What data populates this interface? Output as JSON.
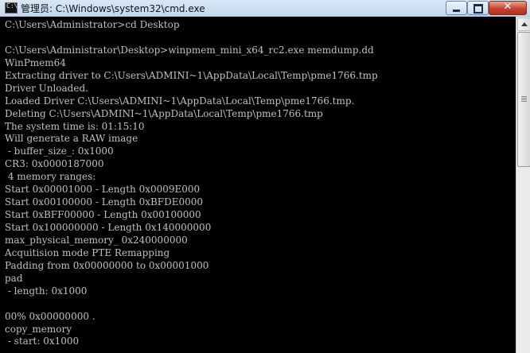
{
  "window": {
    "title": "管理员: C:\\Windows\\system32\\cmd.exe",
    "icon": "cmd-icon",
    "icon_glyph": "C:\\",
    "controls": {
      "minimize_icon": "minimize-icon",
      "maximize_icon": "maximize-icon",
      "close_icon": "close-icon",
      "close_glyph": "✕"
    }
  },
  "console": {
    "lines": [
      "C:\\Users\\Administrator>cd Desktop",
      "",
      "C:\\Users\\Administrator\\Desktop>winpmem_mini_x64_rc2.exe memdump.dd",
      "WinPmem64",
      "Extracting driver to C:\\Users\\ADMINI~1\\AppData\\Local\\Temp\\pme1766.tmp",
      "Driver Unloaded.",
      "Loaded Driver C:\\Users\\ADMINI~1\\AppData\\Local\\Temp\\pme1766.tmp.",
      "Deleting C:\\Users\\ADMINI~1\\AppData\\Local\\Temp\\pme1766.tmp",
      "The system time is: 01:15:10",
      "Will generate a RAW image",
      " - buffer_size_: 0x1000",
      "CR3: 0x0000187000",
      " 4 memory ranges:",
      "Start 0x00001000 - Length 0x0009E000",
      "Start 0x00100000 - Length 0xBFDE0000",
      "Start 0xBFF00000 - Length 0x00100000",
      "Start 0x100000000 - Length 0x140000000",
      "max_physical_memory_ 0x240000000",
      "Acquitision mode PTE Remapping",
      "Padding from 0x00000000 to 0x00001000",
      "pad",
      " - length: 0x1000",
      "",
      "00% 0x00000000 .",
      "copy_memory",
      " - start: 0x1000"
    ],
    "text_color": "#c0c0c0",
    "background": "#000000"
  }
}
